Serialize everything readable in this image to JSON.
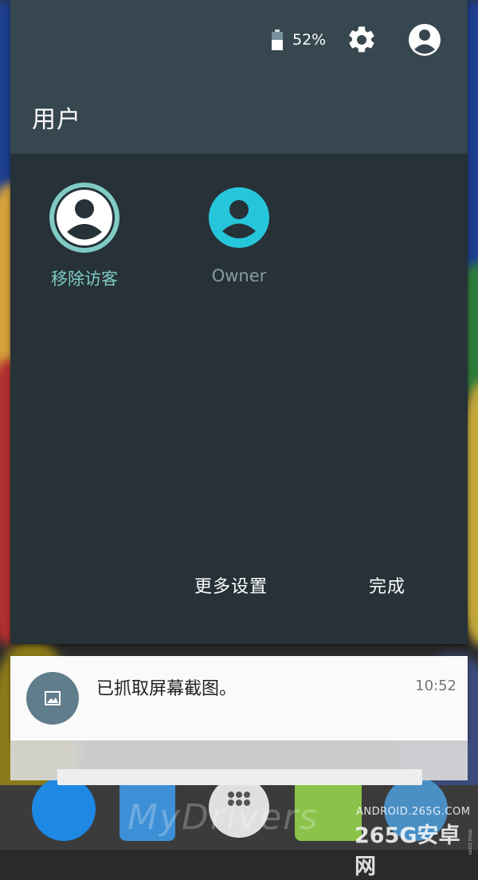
{
  "header": {
    "battery_percent": "52%",
    "title": "用户"
  },
  "users": [
    {
      "label": "移除访客",
      "icon": "guest-avatar-icon",
      "color": "#80cbc4"
    },
    {
      "label": "Owner",
      "icon": "owner-avatar-icon",
      "color": "#8a9ba3"
    }
  ],
  "footer": {
    "more_settings": "更多设置",
    "done": "完成"
  },
  "notification": {
    "title": "已抓取屏幕截图。",
    "time": "10:52",
    "icon": "image-icon"
  },
  "watermarks": {
    "site_url": "ANDROID.265G.COM",
    "site_name": "265G安卓网",
    "brand": "MyDrivers",
    "small": "miui.com"
  },
  "colors": {
    "panel_bg": "#263238",
    "header_bg": "#37474f",
    "guest_accent": "#80cbc4",
    "owner_accent": "#26c6da",
    "notif_icon_bg": "#607d8b"
  }
}
